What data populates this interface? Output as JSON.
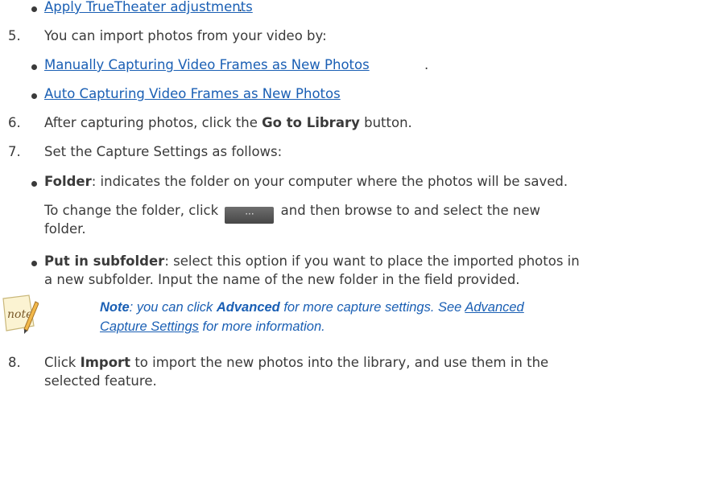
{
  "item4_links": [
    "Apply TrueTheater adjustments"
  ],
  "step5": {
    "num": "5.",
    "text": "You can import photos from your video by:"
  },
  "step5_links": [
    "Manually Capturing Video Frames as New Photos",
    "Auto Capturing Video Frames as New Photos"
  ],
  "step6": {
    "num": "6.",
    "pre": "After capturing photos, click the ",
    "bold": "Go to Library",
    "post": " button."
  },
  "step7": {
    "num": "7.",
    "text": "Set the Capture Settings as follows:"
  },
  "folder": {
    "bold": "Folder",
    "text": ": indicates the folder on your computer where the photos will be saved.",
    "change_pre": "To change the folder, click",
    "button_label": "···",
    "change_post": "and then browse to and select the new",
    "change_tail": "folder."
  },
  "subfolder": {
    "bold": "Put in subfolder",
    "line1": ": select this option if you want to place the imported photos in",
    "line2": "a new subfolder. Input the name of the new folder in the field provided."
  },
  "note": {
    "label": "Note",
    "pre": ": you can click ",
    "bold": "Advanced",
    "mid": " for more capture settings. See ",
    "link1": "Advanced",
    "link2": "Capture Settings",
    "post": " for more information."
  },
  "step8": {
    "num": "8.",
    "pre": "Click ",
    "bold": "Import",
    "line1_post": " to import the new photos into the library, and use them in the",
    "line2": "selected feature."
  },
  "colors": {
    "link": "#1a5fb4",
    "text": "#3a3a3a"
  },
  "icons": {
    "note": "note-pencil-icon"
  }
}
